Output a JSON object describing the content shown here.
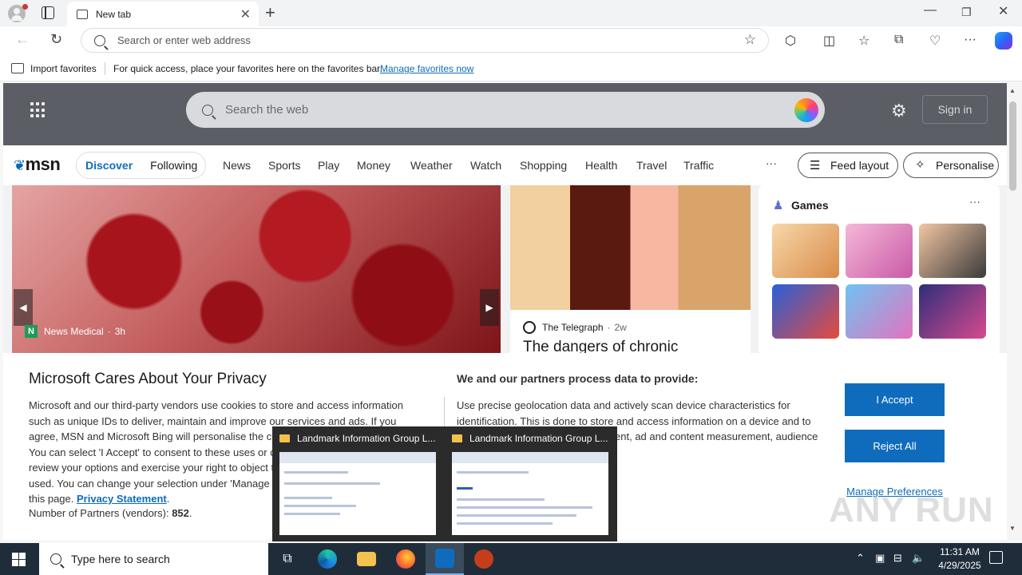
{
  "browser": {
    "tab_title": "New tab",
    "address_placeholder": "Search or enter web address",
    "favorites_bar": {
      "import_label": "Import favorites",
      "message": "For quick access, place your favorites here on the favorites bar.",
      "link": "Manage favorites now"
    }
  },
  "msn": {
    "search_placeholder": "Search the web",
    "sign_in": "Sign in",
    "logo": "msn",
    "pills": [
      "Discover",
      "Following"
    ],
    "nav": [
      "News",
      "Sports",
      "Play",
      "Money",
      "Weather",
      "Watch",
      "Shopping",
      "Health",
      "Travel",
      "Traffic"
    ],
    "more": "···",
    "feed_layout": "Feed layout",
    "personalise": "Personalise",
    "hero": {
      "source_logo": "N",
      "source": "News Medical",
      "age": "3h"
    },
    "card2": {
      "source": "The Telegraph",
      "age": "2w",
      "title": "The dangers of chronic"
    },
    "games": {
      "title": "Games",
      "more": "···"
    }
  },
  "privacy": {
    "title": "Microsoft Cares About Your Privacy",
    "body": "Microsoft and our third-party vendors use cookies to store and access information such as unique IDs to deliver, maintain and improve our services and ads. If you agree, MSN and Microsoft Bing will personalise the content and ads that you see. You can select 'I Accept' to consent to these uses or click on 'Manage preferences' to review your options and exercise your right to object to legitimate interests where used. You can change your selection under 'Manage Preferences' at the bottom of this page.",
    "privacy_link": "Privacy Statement",
    "partners_label": "Number of Partners (vendors):",
    "partners_count": "852",
    "heading2": "We and our partners process data to provide:",
    "body2": "Use precise geolocation data and actively scan device characteristics for identification. This is done to store and access information on a device and to provide personalised ads and content, ad and content measurement, audience insights and product development.",
    "accept": "I Accept",
    "reject": "Reject All",
    "manage": "Manage Preferences"
  },
  "thumbnails": [
    {
      "title": "Landmark Information Group L..."
    },
    {
      "title": "Landmark Information Group L..."
    }
  ],
  "watermark": "ANY RUN",
  "taskbar": {
    "search_placeholder": "Type here to search",
    "time": "11:31 AM",
    "date": "4/29/2025"
  }
}
